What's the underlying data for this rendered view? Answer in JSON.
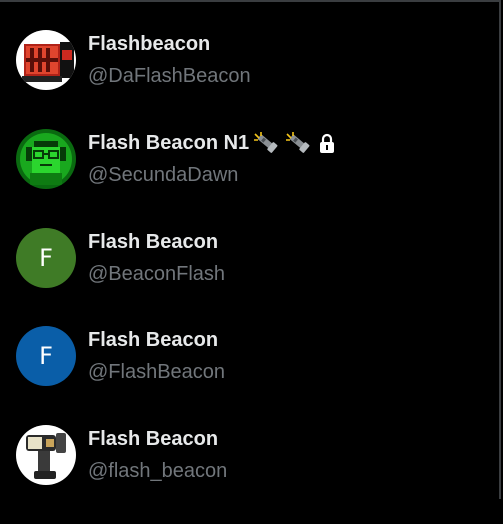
{
  "accounts": [
    {
      "name": "Flashbeacon",
      "handle": "@DaFlashBeacon",
      "avatar_icon": "red-flashbeacon-avatar"
    },
    {
      "name": "Flash Beacon N1",
      "handle": "@SecundaDawn",
      "avatar_icon": "green-pixel-avatar",
      "badges": [
        "flashlight-emoji",
        "flashlight-emoji",
        "lock-icon"
      ]
    },
    {
      "name": "Flash Beacon",
      "handle": "@BeaconFlash",
      "avatar_letter": "F",
      "avatar_color": "#3f7b26"
    },
    {
      "name": "Flash Beacon",
      "handle": "@FlashBeacon",
      "avatar_letter": "F",
      "avatar_color": "#0a5ea8"
    },
    {
      "name": "Flash Beacon",
      "handle": "@flash_beacon",
      "avatar_icon": "flashbeacon-device-avatar"
    }
  ],
  "colors": {
    "background": "#000000",
    "name_text": "#e7e9ea",
    "handle_text": "#71767b"
  }
}
